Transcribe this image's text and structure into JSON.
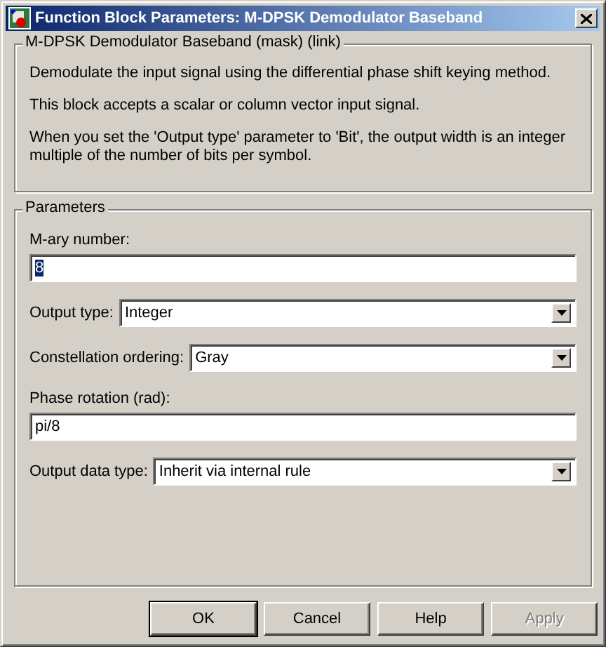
{
  "window": {
    "title": "Function Block Parameters: M-DPSK Demodulator Baseband"
  },
  "description": {
    "title": "M-DPSK Demodulator Baseband (mask) (link)",
    "paragraphs": [
      "Demodulate the input signal using the differential phase shift keying method.",
      "This block accepts a scalar or column vector input signal.",
      "When you set the 'Output type' parameter to 'Bit', the output width is an integer multiple of the number of bits per symbol."
    ]
  },
  "parameters": {
    "title": "Parameters",
    "items": [
      {
        "kind": "edit",
        "label": "M-ary number:",
        "value": "8",
        "text_selected": true
      },
      {
        "kind": "popup",
        "label": "Output type:",
        "value": "Integer"
      },
      {
        "kind": "popup",
        "label": "Constellation ordering:",
        "value": "Gray"
      },
      {
        "kind": "edit",
        "label": "Phase rotation (rad):",
        "value": "pi/8",
        "text_selected": false
      },
      {
        "kind": "popup",
        "label": "Output data type:",
        "value": "Inherit via internal rule"
      }
    ]
  },
  "buttons": [
    {
      "label": "OK",
      "default": true,
      "disabled": false
    },
    {
      "label": "Cancel",
      "default": false,
      "disabled": false
    },
    {
      "label": "Help",
      "default": false,
      "disabled": false
    },
    {
      "label": "Apply",
      "default": false,
      "disabled": true
    }
  ]
}
